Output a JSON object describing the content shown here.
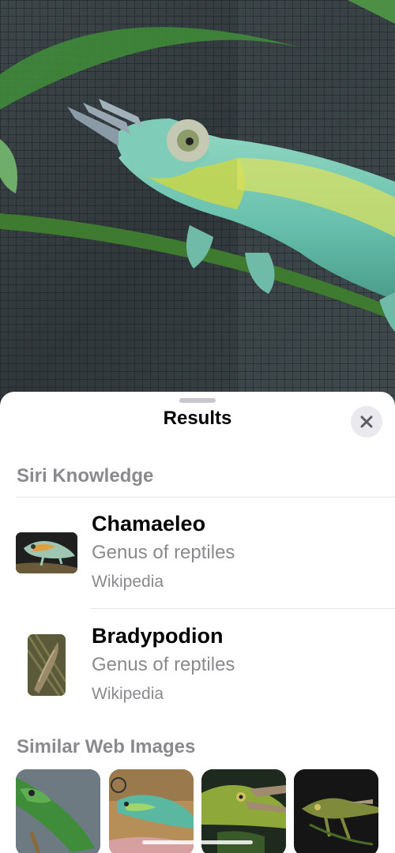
{
  "photo": {
    "subject_icon": "chameleon-photo"
  },
  "sheet": {
    "title": "Results",
    "close_icon": "close-icon"
  },
  "siri_knowledge": {
    "heading": "Siri Knowledge",
    "results": [
      {
        "title": "Chamaeleo",
        "subtitle": "Genus of reptiles",
        "source": "Wikipedia"
      },
      {
        "title": "Bradypodion",
        "subtitle": "Genus of reptiles",
        "source": "Wikipedia"
      }
    ]
  },
  "similar_web_images": {
    "heading": "Similar Web Images",
    "count": 4
  },
  "colors": {
    "accent_text": "#000000",
    "secondary_text": "#8a8a8e",
    "sheet_bg": "#ffffff",
    "close_bg": "#e9e9ee"
  }
}
